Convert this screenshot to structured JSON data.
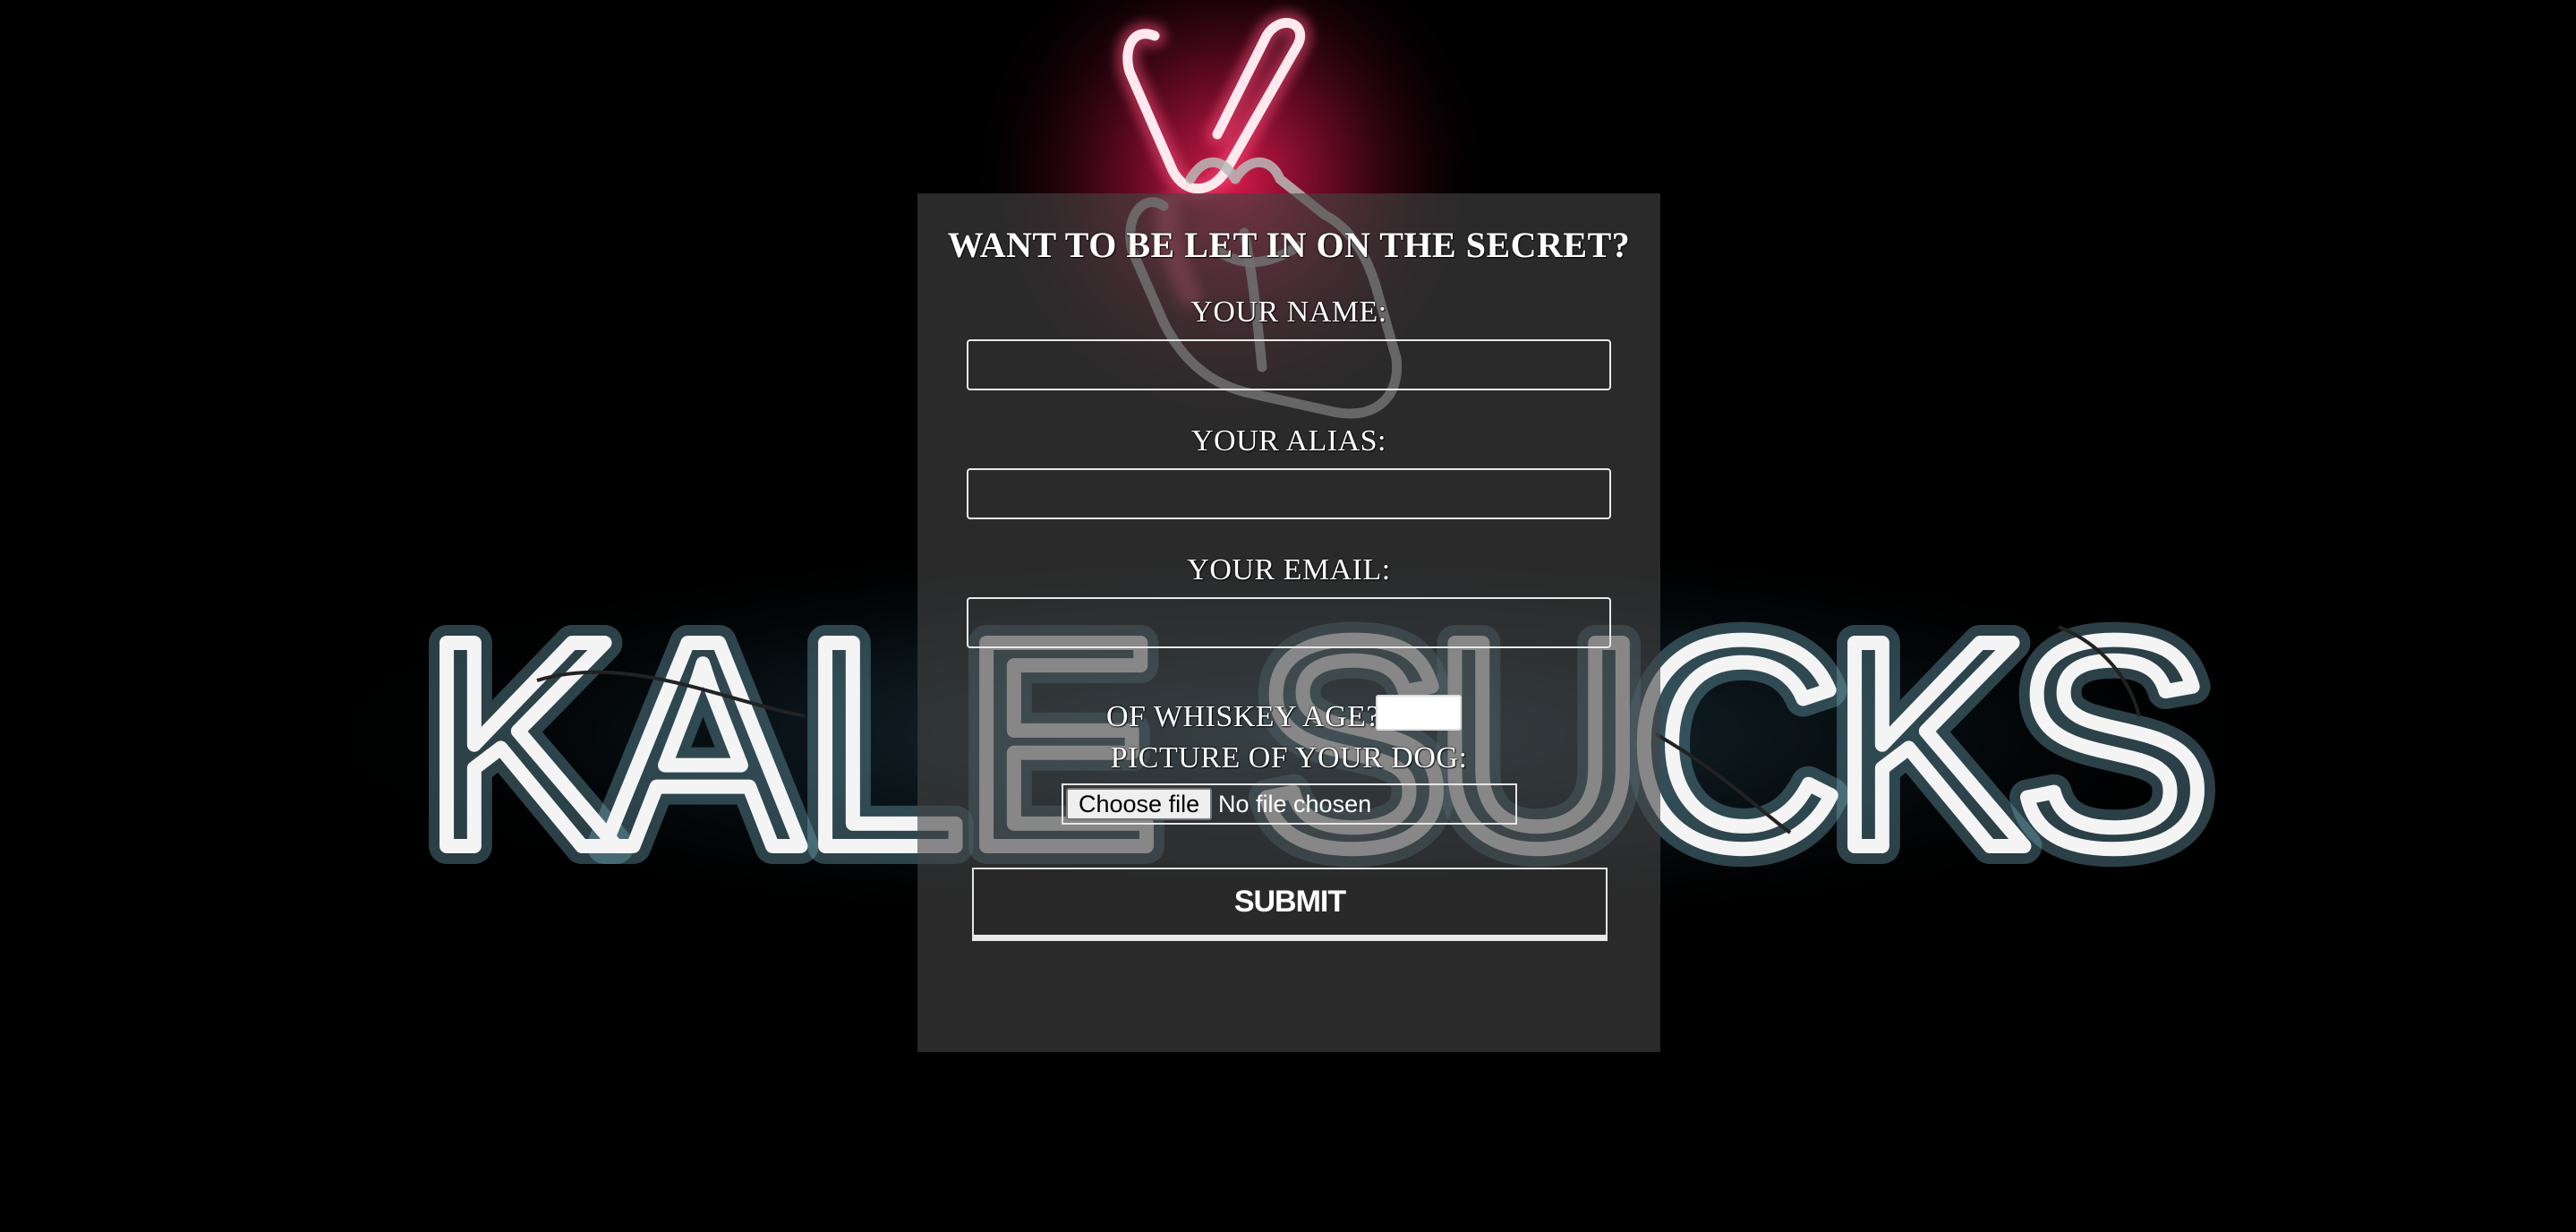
{
  "background": {
    "sign_text": "KALE SUCKS",
    "sign_letters": [
      "K",
      "A",
      "L",
      "E",
      "S",
      "U",
      "C",
      "K",
      "S"
    ],
    "sign_color": "#f4f4f4",
    "peace_sign_color": "#ff3b6b",
    "page_color": "#000000"
  },
  "form": {
    "title": "WANT TO BE LET IN ON THE SECRET?",
    "name_label": "YOUR NAME:",
    "alias_label": "YOUR ALIAS:",
    "email_label": "YOUR EMAIL:",
    "whiskey_label": "OF WHISKEY AGE?",
    "dog_picture_label": "PICTURE OF YOUR DOG:",
    "choose_file_label": "Choose file",
    "file_status": "No file chosen",
    "submit_label": "SUBMIT",
    "name_value": "",
    "alias_value": "",
    "email_value": "",
    "whiskey_value": "",
    "panel_color": "#444444",
    "text_color": "#ffffff"
  }
}
